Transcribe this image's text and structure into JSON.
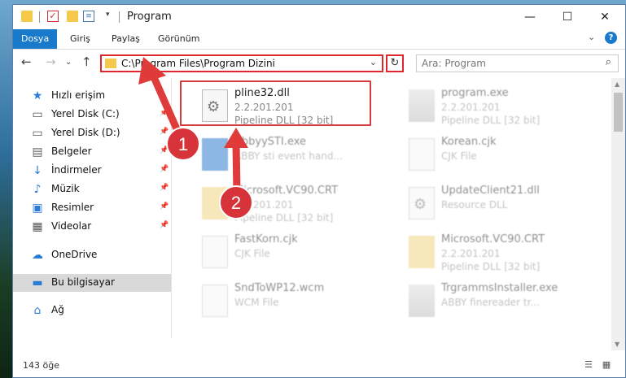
{
  "window": {
    "title": "Program"
  },
  "ribbon": {
    "tabs": [
      "Dosya",
      "Giriş",
      "Paylaş",
      "Görünüm"
    ],
    "help": "?"
  },
  "titlebar": {
    "minimize": "—",
    "maximize": "☐",
    "close": "✕"
  },
  "address": {
    "path": "C:\\Program Files\\Program Dizini",
    "dropdown": "⌄",
    "refresh": "↻"
  },
  "search": {
    "placeholder": "Ara: Program",
    "icon": "⌕"
  },
  "nav": {
    "back": "←",
    "forward": "→",
    "up": "↑",
    "recent": "⌄"
  },
  "sidebar": {
    "items": [
      {
        "label": "Hızlı erişim",
        "icon": "★",
        "pinned": false
      },
      {
        "label": "Yerel Disk (C:)",
        "icon": "▭",
        "pinned": true
      },
      {
        "label": "Yerel Disk (D:)",
        "icon": "▭",
        "pinned": true
      },
      {
        "label": "Belgeler",
        "icon": "▤",
        "pinned": true
      },
      {
        "label": "İndirmeler",
        "icon": "↓",
        "pinned": true
      },
      {
        "label": "Müzik",
        "icon": "♪",
        "pinned": true
      },
      {
        "label": "Resimler",
        "icon": "▣",
        "pinned": true
      },
      {
        "label": "Videolar",
        "icon": "▦",
        "pinned": true
      },
      {
        "label": "OneDrive",
        "icon": "☁",
        "pinned": false
      },
      {
        "label": "Bu bilgisayar",
        "icon": "▬",
        "pinned": false
      },
      {
        "label": "Ağ",
        "icon": "⌂",
        "pinned": false
      }
    ]
  },
  "files": [
    {
      "name": "pline32.dll",
      "line2": "2.2.201.201",
      "line3": "Pipeline DLL [32 bit]"
    },
    {
      "name": "program.exe",
      "line2": "2.2.201.201",
      "line3": "Pipeline DLL [32 bit]"
    },
    {
      "name": "AbbyySTI.exe",
      "line2": "ABBY sti event hand...",
      "line3": ""
    },
    {
      "name": "Korean.cjk",
      "line2": "CJK File",
      "line3": ""
    },
    {
      "name": "Microsoft.VC90.CRT",
      "line2": "2.2.201.201",
      "line3": "Pipeline DLL [32 bit]"
    },
    {
      "name": "UpdateClient21.dll",
      "line2": "Resource DLL",
      "line3": ""
    },
    {
      "name": "FastKorn.cjk",
      "line2": "CJK File",
      "line3": ""
    },
    {
      "name": "Microsoft.VC90.CRT",
      "line2": "2.2.201.201",
      "line3": "Pipeline DLL [32 bit]"
    },
    {
      "name": "SndToWP12.wcm",
      "line2": "WCM File",
      "line3": ""
    },
    {
      "name": "TrgrammsInstaller.exe",
      "line2": "ABBY finereader tr...",
      "line3": ""
    }
  ],
  "status": {
    "count": "143 öğe"
  },
  "annotations": {
    "label1": "1",
    "label2": "2"
  },
  "colors": {
    "accent": "#1979ca",
    "highlight": "#e0262d",
    "arrow": "#e03b3b"
  }
}
